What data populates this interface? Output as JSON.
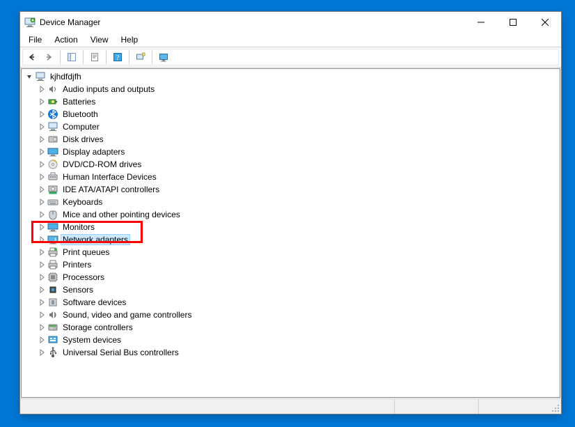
{
  "window": {
    "title": "Device Manager"
  },
  "menu": {
    "file": "File",
    "action": "Action",
    "view": "View",
    "help": "Help"
  },
  "tree": {
    "root": {
      "label": "kjhdfdjfh",
      "expanded": true
    },
    "items": [
      {
        "label": "Audio inputs and outputs",
        "icon": "audio"
      },
      {
        "label": "Batteries",
        "icon": "battery"
      },
      {
        "label": "Bluetooth",
        "icon": "bluetooth"
      },
      {
        "label": "Computer",
        "icon": "computer"
      },
      {
        "label": "Disk drives",
        "icon": "disk"
      },
      {
        "label": "Display adapters",
        "icon": "display"
      },
      {
        "label": "DVD/CD-ROM drives",
        "icon": "dvd"
      },
      {
        "label": "Human Interface Devices",
        "icon": "hid"
      },
      {
        "label": "IDE ATA/ATAPI controllers",
        "icon": "ide"
      },
      {
        "label": "Keyboards",
        "icon": "keyboard"
      },
      {
        "label": "Mice and other pointing devices",
        "icon": "mouse"
      },
      {
        "label": "Monitors",
        "icon": "monitor"
      },
      {
        "label": "Network adapters",
        "icon": "network",
        "selected": true,
        "highlighted": true
      },
      {
        "label": "Print queues",
        "icon": "printqueue"
      },
      {
        "label": "Printers",
        "icon": "printer"
      },
      {
        "label": "Processors",
        "icon": "cpu"
      },
      {
        "label": "Sensors",
        "icon": "sensor"
      },
      {
        "label": "Software devices",
        "icon": "software"
      },
      {
        "label": "Sound, video and game controllers",
        "icon": "sound"
      },
      {
        "label": "Storage controllers",
        "icon": "storage"
      },
      {
        "label": "System devices",
        "icon": "system"
      },
      {
        "label": "Universal Serial Bus controllers",
        "icon": "usb"
      }
    ]
  }
}
